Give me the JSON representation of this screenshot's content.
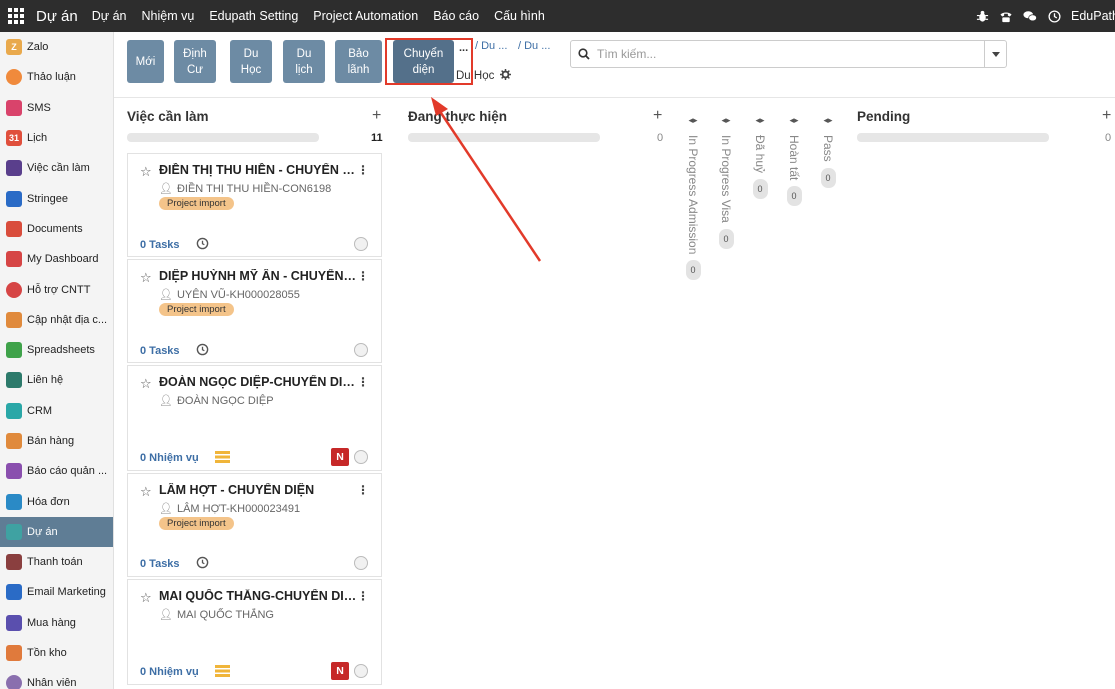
{
  "topbar": {
    "brand": "Dự án",
    "menu": [
      "Dự án",
      "Nhiệm vụ",
      "Edupath Setting",
      "Project Automation",
      "Báo cáo",
      "Cấu hình"
    ],
    "company": "EduPath"
  },
  "sidebar": {
    "items": [
      {
        "label": "Zalo",
        "color": "#e9a94c"
      },
      {
        "label": "Thảo luận",
        "color": "#f08a3c"
      },
      {
        "label": "SMS",
        "color": "#d9436b"
      },
      {
        "label": "Lịch",
        "color": "#e04f3c"
      },
      {
        "label": "Việc cần làm",
        "color": "#5a3f8c"
      },
      {
        "label": "Stringee",
        "color": "#2a6bc6"
      },
      {
        "label": "Documents",
        "color": "#d94d3c"
      },
      {
        "label": "My Dashboard",
        "color": "#d64545"
      },
      {
        "label": "Hỗ trợ CNTT",
        "color": "#d64545"
      },
      {
        "label": "Cập nhật địa c...",
        "color": "#e08a3c"
      },
      {
        "label": "Spreadsheets",
        "color": "#3fa24a"
      },
      {
        "label": "Liên hệ",
        "color": "#2d7a6b"
      },
      {
        "label": "CRM",
        "color": "#2aa7a7"
      },
      {
        "label": "Bán hàng",
        "color": "#e08a3c"
      },
      {
        "label": "Báo cáo quản ...",
        "color": "#8a4fae"
      },
      {
        "label": "Hóa đơn",
        "color": "#2a8ac6"
      },
      {
        "label": "Dự án",
        "color": "#3fa2a2",
        "active": true
      },
      {
        "label": "Thanh toán",
        "color": "#8a3f3f"
      },
      {
        "label": "Email Marketing",
        "color": "#2a6bc6"
      },
      {
        "label": "Mua hàng",
        "color": "#5a4fae"
      },
      {
        "label": "Tồn kho",
        "color": "#e07a3c"
      },
      {
        "label": "Nhân viên",
        "color": "#8a6fae"
      }
    ]
  },
  "control": {
    "buttons": [
      {
        "label": "Mới"
      },
      {
        "label": "Định Cư"
      },
      {
        "label": "Du Học"
      },
      {
        "label": "Du lịch"
      },
      {
        "label": "Bảo lãnh"
      },
      {
        "label": "Chuyển diện"
      }
    ],
    "breadcrumb": {
      "dots": "...",
      "item1": "/ Du ...",
      "item2": "/ Du ...",
      "current": "Du Học"
    },
    "search": {
      "placeholder": "Tìm kiếm..."
    }
  },
  "columns": {
    "todo": {
      "title": "Việc cần làm",
      "count": "11"
    },
    "inprogress": {
      "title": "Đang thực hiện",
      "count": "0"
    },
    "pending": {
      "title": "Pending",
      "count": "0"
    }
  },
  "folded_columns": [
    {
      "label": "In Progress Admission",
      "count": "0"
    },
    {
      "label": "In Progress Visa",
      "count": "0"
    },
    {
      "label": "Đã huỷ",
      "count": "0"
    },
    {
      "label": "Hoàn tất",
      "count": "0"
    },
    {
      "label": "Pass",
      "count": "0"
    }
  ],
  "cards": [
    {
      "title": "ĐIỀN THỊ THU HIỀN - CHUYỂN DIỆN",
      "customer": "ĐIỀN THỊ THU HIỀN-CON6198",
      "tag": "Project import",
      "tasks": "0 Tasks",
      "footer": "clock"
    },
    {
      "title": "DIỆP HUỲNH MỸ ÂN - CHUYỂN DIỆN",
      "customer": "UYÊN VŨ-KH000028055",
      "tag": "Project import",
      "tasks": "0 Tasks",
      "footer": "clock"
    },
    {
      "title": "ĐOÀN NGỌC DIỆP-CHUYỂN DIỆN",
      "customer": "ĐOÀN NGỌC DIỆP",
      "tag": "",
      "tasks": "0 Nhiệm vụ",
      "footer": "layers",
      "badge": "N"
    },
    {
      "title": "LÂM HỢT - CHUYỂN DIỆN",
      "customer": "LÂM HỢT-KH000023491",
      "tag": "Project import",
      "tasks": "0 Tasks",
      "footer": "clock"
    },
    {
      "title": "MAI QUỐC THẮNG-CHUYỂN DIỆN",
      "customer": "MAI QUỐC THẮNG",
      "tag": "",
      "tasks": "0 Nhiệm vụ",
      "footer": "layers",
      "badge": "N"
    }
  ],
  "colors": {
    "accent": "#6d8ba4",
    "topbar": "#2d2d2d",
    "highlight": "#e23a2a",
    "tag": "#f4c48a",
    "badge": "#c62828"
  }
}
